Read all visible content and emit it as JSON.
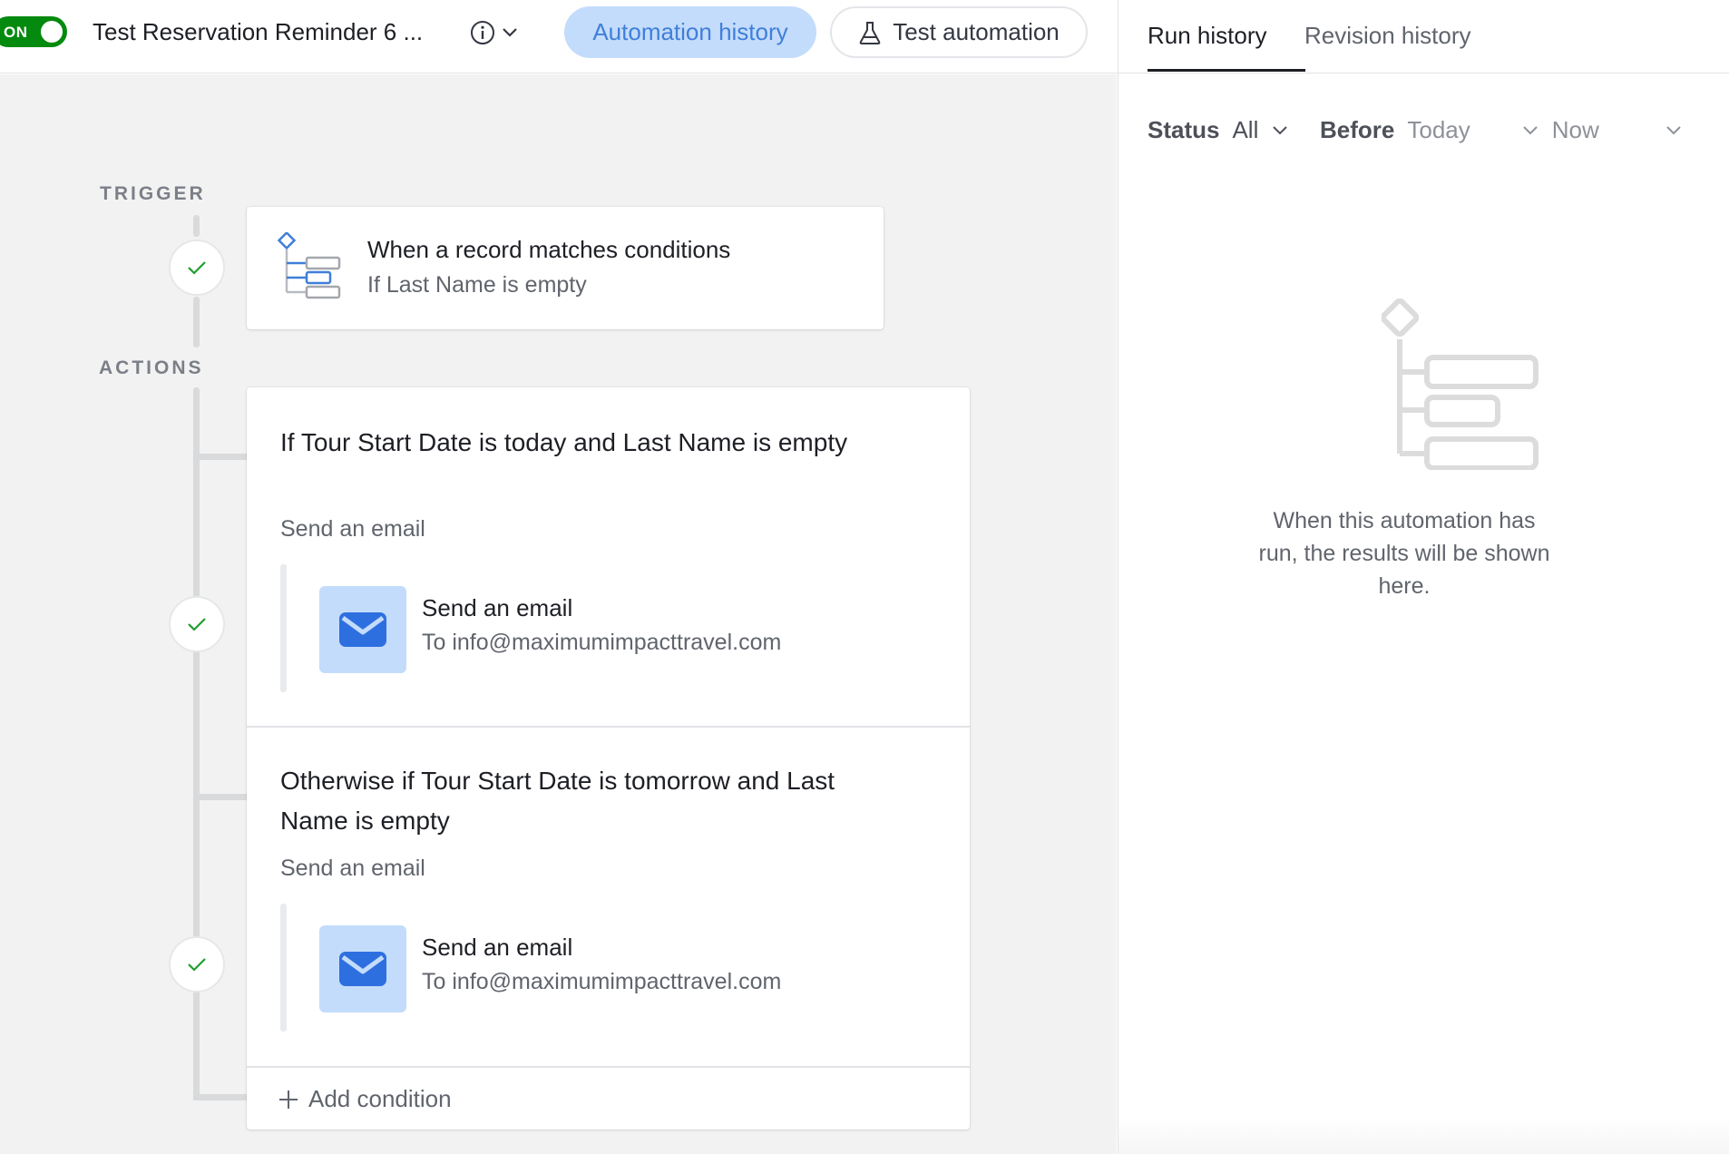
{
  "header": {
    "toggle_label": "ON",
    "automation_title": "Test Reservation Reminder 6 ...",
    "automation_history_label": "Automation history",
    "test_automation_label": "Test automation"
  },
  "canvas": {
    "trigger_section_label": "TRIGGER",
    "actions_section_label": "ACTIONS",
    "trigger": {
      "title": "When a record matches conditions",
      "subtitle": "If Last Name is empty"
    },
    "branches": [
      {
        "title": "If Tour Start Date is today and Last Name is empty",
        "action_label": "Send an email",
        "action_title": "Send an email",
        "action_subtitle": "To info@maximumimpacttravel.com"
      },
      {
        "title": "Otherwise if Tour Start Date is tomorrow and Last Name is empty",
        "action_label": "Send an email",
        "action_title": "Send an email",
        "action_subtitle": "To info@maximumimpacttravel.com"
      }
    ],
    "add_condition_label": "Add condition"
  },
  "right_panel": {
    "tabs": [
      {
        "label": "Run history",
        "active": true
      },
      {
        "label": "Revision history",
        "active": false
      }
    ],
    "filters": {
      "status_key": "Status",
      "status_value": "All",
      "before_key": "Before",
      "before_date": "Today",
      "before_time": "Now"
    },
    "empty_message": "When this automation has run, the results will be shown here."
  },
  "colors": {
    "toggle_on": "#048a0e",
    "accent_blue": "#3f7fd9",
    "accent_blue_bg": "#c4dcfb",
    "check_green": "#1f9e2c",
    "canvas_bg": "#f2f2f2"
  }
}
